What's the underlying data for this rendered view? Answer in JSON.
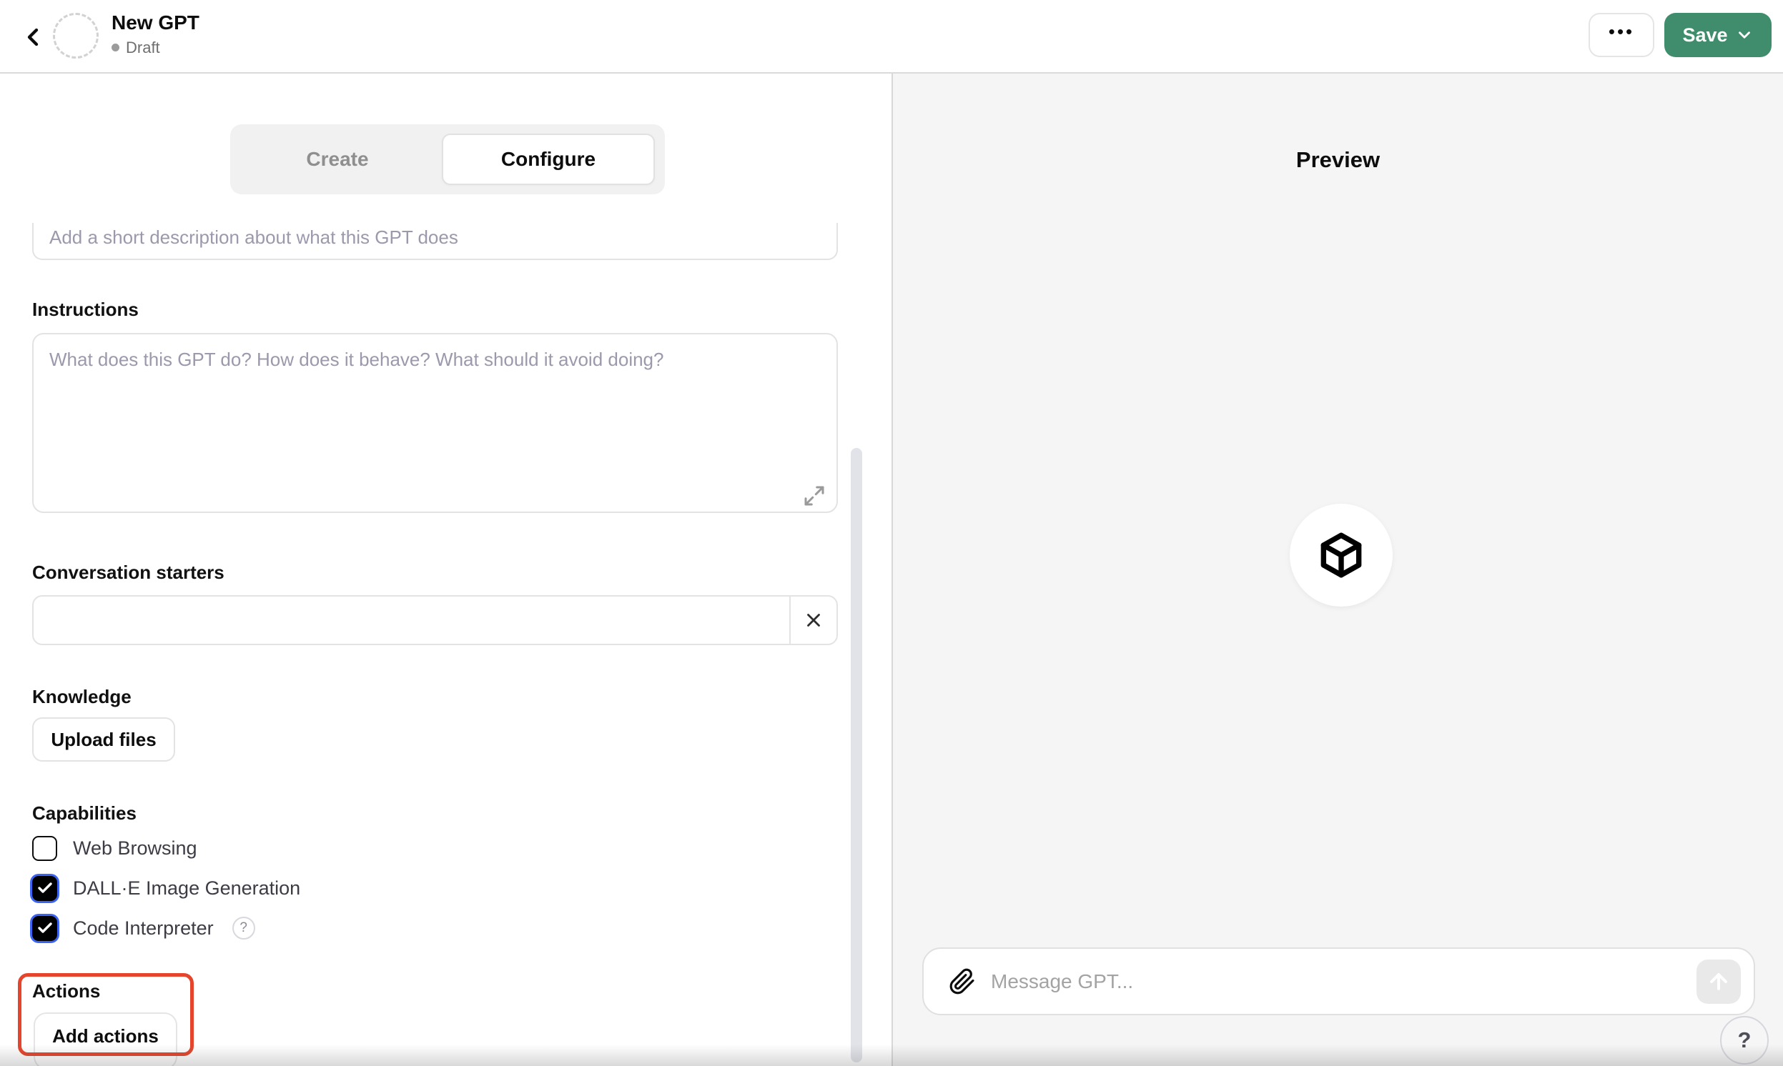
{
  "header": {
    "title": "New GPT",
    "status": "Draft",
    "more_label": "•••",
    "save_label": "Save"
  },
  "tabs": {
    "create": "Create",
    "configure": "Configure"
  },
  "form": {
    "description_placeholder": "Add a short description about what this GPT does",
    "instructions_label": "Instructions",
    "instructions_placeholder": "What does this GPT do? How does it behave? What should it avoid doing?",
    "starters_label": "Conversation starters",
    "starter_value": "",
    "knowledge_label": "Knowledge",
    "upload_button": "Upload files",
    "capabilities_label": "Capabilities",
    "capabilities": [
      {
        "label": "Web Browsing",
        "checked": false
      },
      {
        "label": "DALL·E Image Generation",
        "checked": true
      },
      {
        "label": "Code Interpreter",
        "checked": true,
        "help_icon": "?"
      }
    ],
    "actions_label": "Actions",
    "add_actions_button": "Add actions"
  },
  "preview": {
    "title": "Preview",
    "message_placeholder": "Message GPT...",
    "help_label": "?"
  },
  "colors": {
    "save_green": "#3f8d6d",
    "annotation_red": "#e4452c",
    "checkbox_ring_blue": "#3c64f1",
    "panel_gray": "#f5f5f5"
  }
}
